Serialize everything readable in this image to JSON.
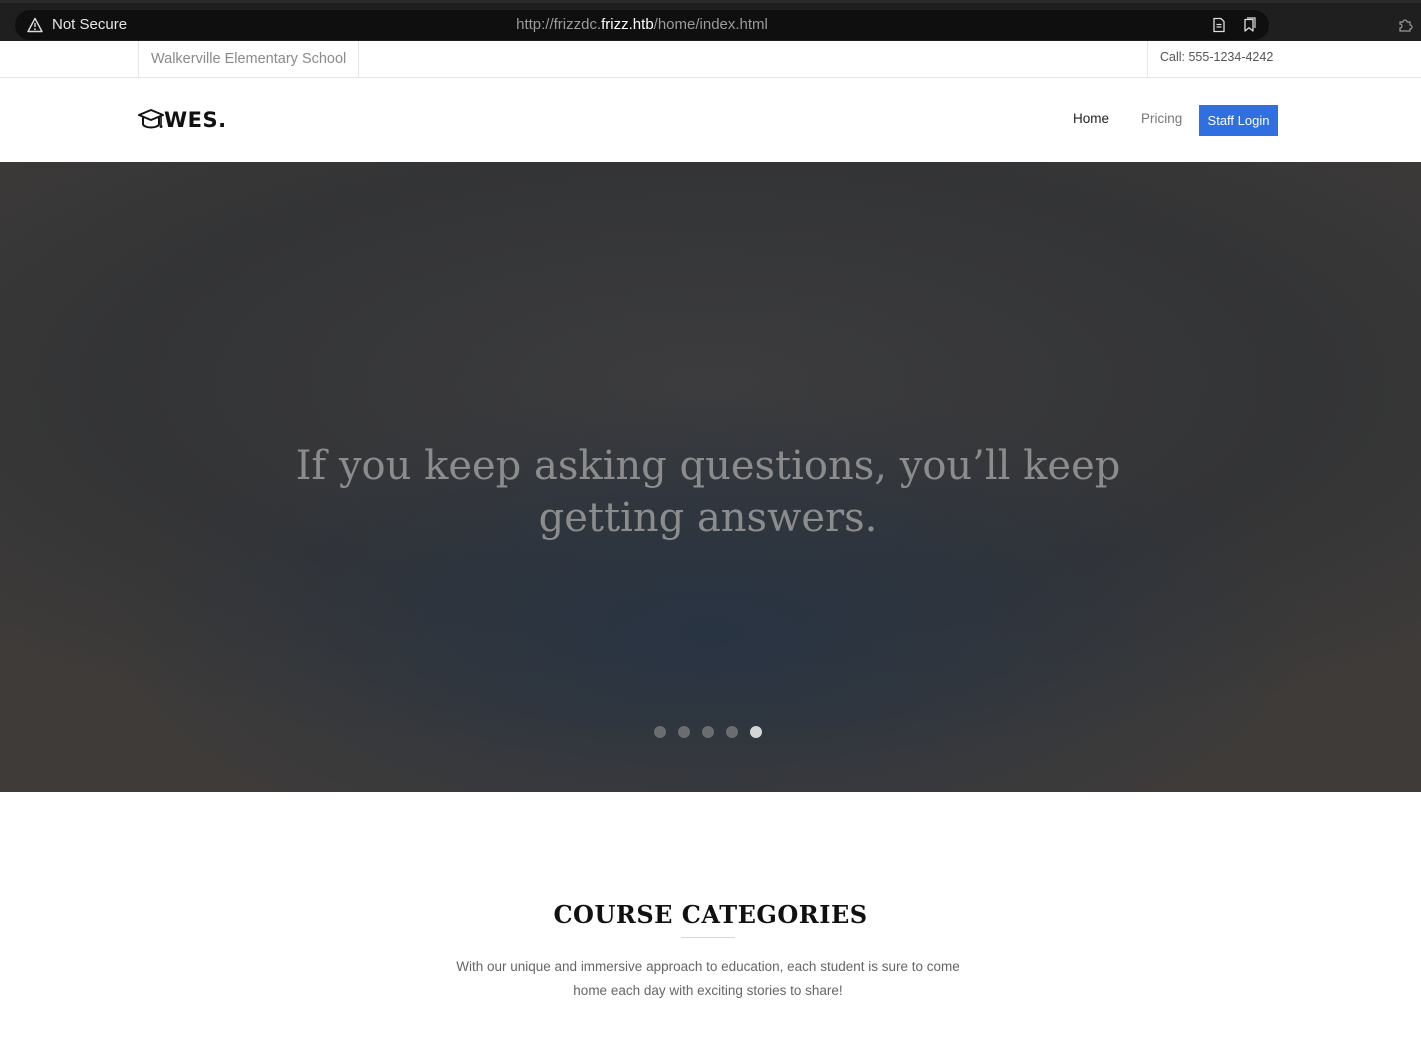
{
  "browser": {
    "security_label": "Not Secure",
    "url_prefix": "http://frizzdc.",
    "url_host": "frizz.htb",
    "url_path": "/home/index.html"
  },
  "topbar": {
    "school_name": "Walkerville Elementary School",
    "phone": "Call: 555-1234-4242"
  },
  "nav": {
    "logo_text": "WES.",
    "items": [
      {
        "label": "Home"
      },
      {
        "label": "Pricing"
      },
      {
        "label": "Staff Login"
      }
    ],
    "login_color": "#2f6fdf"
  },
  "hero": {
    "quote": "If you keep asking questions, you’ll keep getting answers.",
    "slides_total": 5,
    "active_slide": 5
  },
  "courses": {
    "title": "COURSE CATEGORIES",
    "description": "With our unique and immersive approach to education, each student is sure to come home each day with exciting stories to share!"
  }
}
